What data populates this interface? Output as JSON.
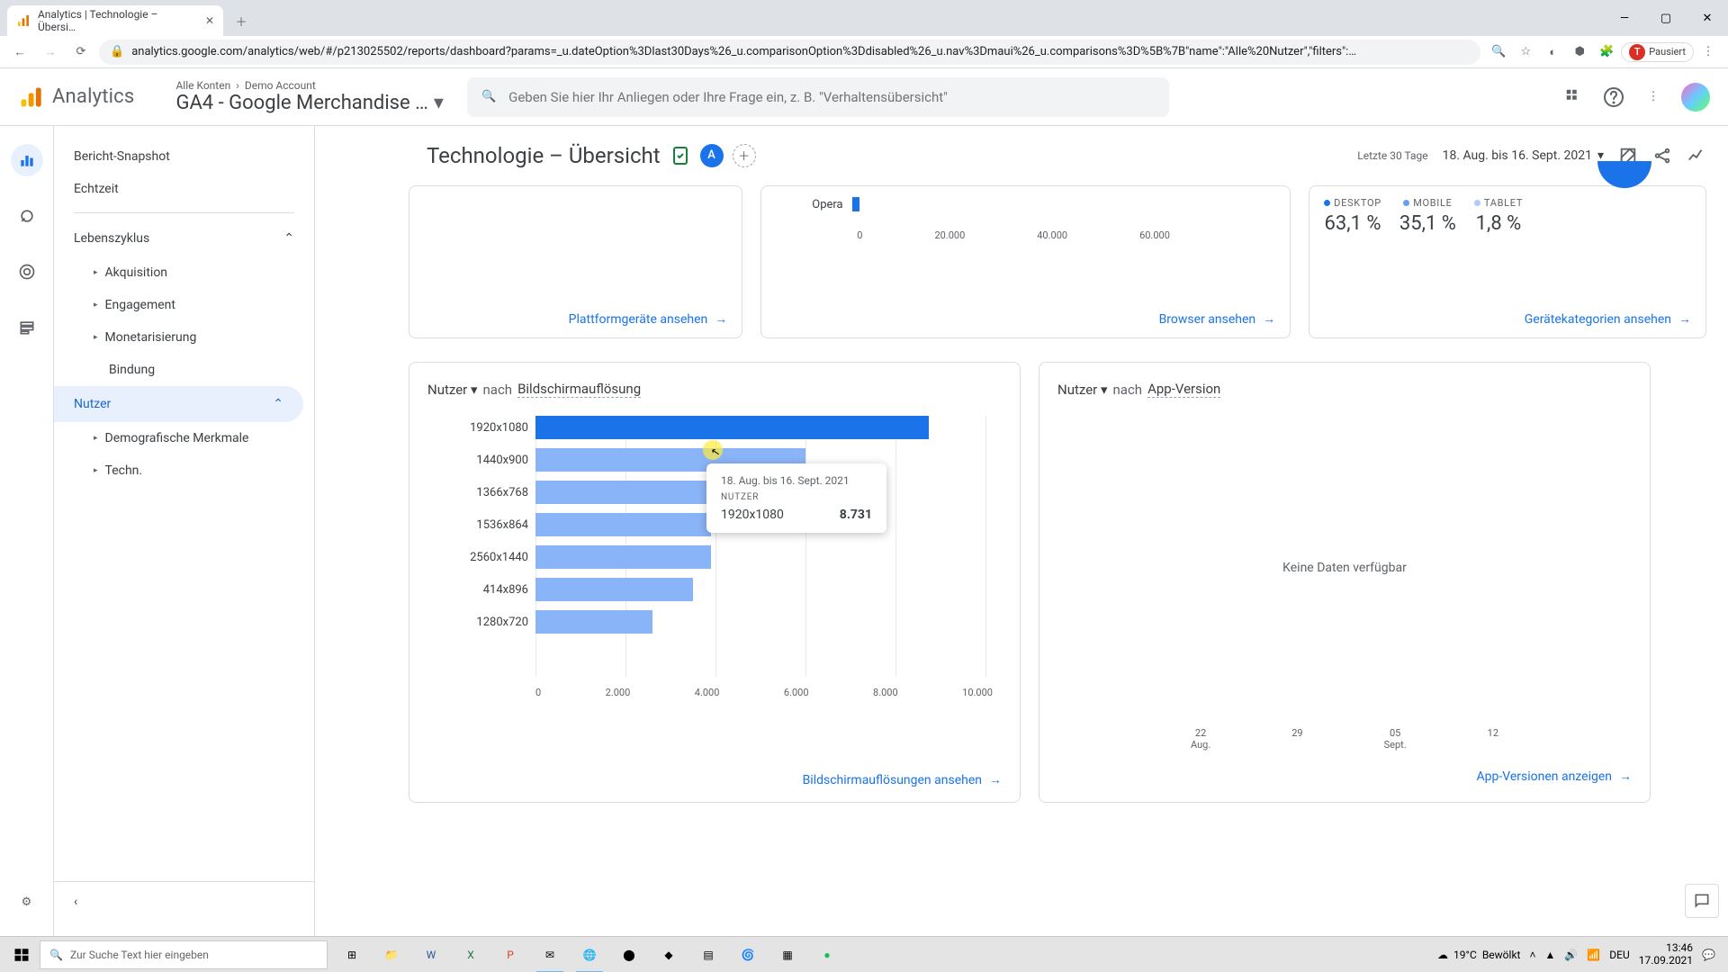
{
  "browser": {
    "tab_title": "Analytics | Technologie – Übersi…",
    "url": "analytics.google.com/analytics/web/#/p213025502/reports/dashboard?params=_u.dateOption%3Dlast30Days%26_u.comparisonOption%3Ddisabled%26_u.nav%3Dmaui%26_u.comparisons%3D%5B%7B\"name\":\"Alle%20Nutzer\",\"filters\":…",
    "paused": "Pausiert"
  },
  "app": {
    "brand": "Analytics",
    "breadcrumb1": "Alle Konten",
    "breadcrumb2": "Demo Account",
    "property": "GA4 - Google Merchandise …",
    "search_placeholder": "Geben Sie hier Ihr Anliegen oder Ihre Frage ein, z. B. \"Verhaltensübersicht\""
  },
  "sidenav": {
    "snapshot": "Bericht-Snapshot",
    "realtime": "Echtzeit",
    "lifecycle": "Lebenszyklus",
    "acquisition": "Akquisition",
    "engagement": "Engagement",
    "monetization": "Monetarisierung",
    "retention": "Bindung",
    "user": "Nutzer",
    "demo": "Demografische Merkmale",
    "tech": "Techn."
  },
  "page": {
    "title": "Technologie – Übersicht",
    "date_label": "Letzte 30 Tage",
    "date_range": "18. Aug. bis 16. Sept. 2021"
  },
  "top_cards": {
    "platform_link": "Plattformgeräte ansehen",
    "opera": "Opera",
    "browser_axis": [
      "0",
      "20.000",
      "40.000",
      "60.000"
    ],
    "browser_link": "Browser ansehen",
    "devices": [
      {
        "name": "DESKTOP",
        "pct": "63,1 %",
        "color": "#1a73e8"
      },
      {
        "name": "MOBILE",
        "pct": "35,1 %",
        "color": "#669df6"
      },
      {
        "name": "TABLET",
        "pct": "1,8 %",
        "color": "#aecbfa"
      }
    ],
    "device_link": "Gerätekategorien ansehen"
  },
  "chart_card": {
    "metric": "Nutzer",
    "by": "nach",
    "dim": "Bildschirmauflösung",
    "view": "Bildschirmauflösungen ansehen",
    "x_ticks": [
      "0",
      "2.000",
      "4.000",
      "6.000",
      "8.000",
      "10.000"
    ]
  },
  "tooltip": {
    "date": "18. Aug. bis 16. Sept. 2021",
    "metric": "NUTZER",
    "dim": "1920x1080",
    "val": "8.731"
  },
  "chart_data": {
    "type": "bar",
    "orientation": "horizontal",
    "title": "Nutzer nach Bildschirmauflösung",
    "xlabel": "",
    "ylabel": "",
    "xlim": [
      0,
      10000
    ],
    "categories": [
      "1920x1080",
      "1440x900",
      "1366x768",
      "1536x864",
      "2560x1440",
      "414x896",
      "1280x720"
    ],
    "values": [
      8731,
      6000,
      4100,
      3900,
      3900,
      3500,
      2600
    ]
  },
  "app_card": {
    "metric": "Nutzer",
    "by": "nach",
    "dim": "App-Version",
    "nodata": "Keine Daten verfügbar",
    "view": "App-Versionen anzeigen",
    "x_ticks": [
      "22\nAug.",
      "29",
      "05\nSept.",
      "12"
    ]
  },
  "taskbar": {
    "search": "Zur Suche Text hier eingeben",
    "weather_temp": "19°C",
    "weather_desc": "Bewölkt",
    "lang": "DEU",
    "time": "13:46",
    "date": "17.09.2021"
  }
}
